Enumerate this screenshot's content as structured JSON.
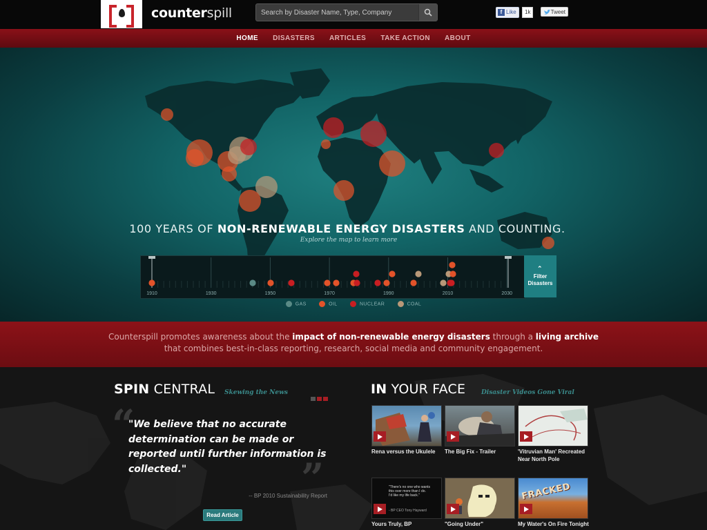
{
  "brand": {
    "name_bold": "counter",
    "name_light": "spill"
  },
  "search": {
    "placeholder": "Search by Disaster Name, Type, Company"
  },
  "social": {
    "like_label": "Like",
    "like_count": "1k",
    "tweet_label": "Tweet"
  },
  "nav": {
    "items": [
      {
        "label": "HOME",
        "active": true
      },
      {
        "label": "DISASTERS"
      },
      {
        "label": "ARTICLES"
      },
      {
        "label": "TAKE ACTION"
      },
      {
        "label": "ABOUT"
      }
    ]
  },
  "hero": {
    "title_pre": "100 YEARS OF ",
    "title_bold": "NON-RENEWABLE ENERGY DISASTERS",
    "title_post": " AND COUNTING.",
    "subtitle": "Explore the map to learn more",
    "filter_button": "Filter Disasters",
    "timeline_years": [
      "1910",
      "1930",
      "1950",
      "1970",
      "1990",
      "2010",
      "2030"
    ],
    "legend": [
      {
        "label": "GAS",
        "color": "#5a8a86"
      },
      {
        "label": "OIL",
        "color": "#e2532a"
      },
      {
        "label": "NUCLEAR",
        "color": "#c81e22"
      },
      {
        "label": "COAL",
        "color": "#b89878"
      }
    ]
  },
  "mission": {
    "part1": "Counterspill promotes awareness about the ",
    "bold1": "impact of non-renewable energy disasters",
    "part2": " through a ",
    "bold2": "living archive",
    "part3": " that combines best-in-class reporting, research, social media and community engagement."
  },
  "spin_central": {
    "title_bold": "SPIN",
    "title_light": " CENTRAL",
    "subtitle": "Skewing the News",
    "quote": "\"We believe that no accurate determination can be made or reported until further information is collected.\"",
    "source": "-- BP 2010 Sustainability Report",
    "button": "Read Article"
  },
  "in_your_face": {
    "title_bold": "IN",
    "title_light": " YOUR FACE",
    "subtitle": "Disaster Videos Gone Viral",
    "videos": [
      {
        "caption": "Rena versus the Ukulele"
      },
      {
        "caption": "The Big Fix - Trailer"
      },
      {
        "caption": "'Vitruvian Man' Recreated Near North Pole"
      },
      {
        "caption": "Yours Truly, BP",
        "thumb_text": "\"There's no one who wants this over more than I do. I'd like my life back.\"",
        "thumb_credit": "- BP CEO Tony Hayward"
      },
      {
        "caption": "\"Going Under\""
      },
      {
        "caption": "My Water's On Fire Tonight",
        "thumb_text": "FRACKED"
      }
    ]
  },
  "colors": {
    "accent_red": "#8c1218",
    "teal": "#1f7f82",
    "oil": "#e2532a",
    "nuclear": "#c81e22",
    "gas": "#5a8a86",
    "coal": "#b89878"
  }
}
